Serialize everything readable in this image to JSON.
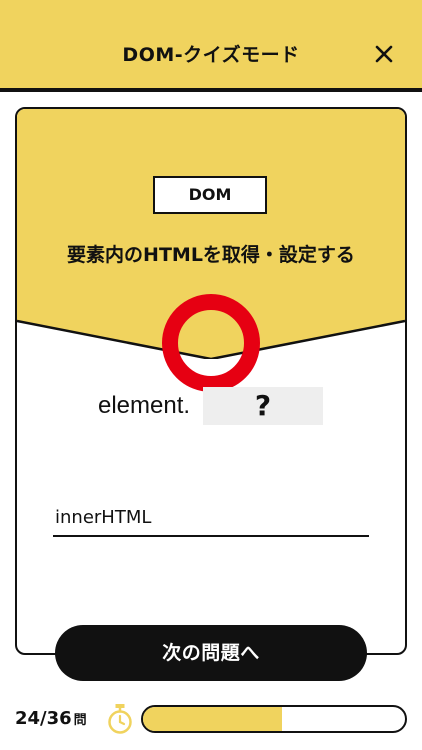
{
  "header": {
    "title": "DOM-クイズモード",
    "close_icon": "close-icon"
  },
  "question": {
    "tag": "DOM",
    "title": "要素内のHTMLを取得・設定する",
    "code_prefix": "element.",
    "blank_placeholder": "?",
    "result": "correct-circle"
  },
  "answer": {
    "value": "innerHTML"
  },
  "next_button": {
    "label": "次の問題へ"
  },
  "progress": {
    "current": "24",
    "total": "36",
    "text": "24/36",
    "unit": "問",
    "timer_icon": "stopwatch-icon",
    "remaining_fraction": 0.53
  },
  "colors": {
    "accent": "#f0d35e",
    "text": "#111111",
    "correct": "#e60012",
    "blank_bg": "#eeeeee"
  }
}
